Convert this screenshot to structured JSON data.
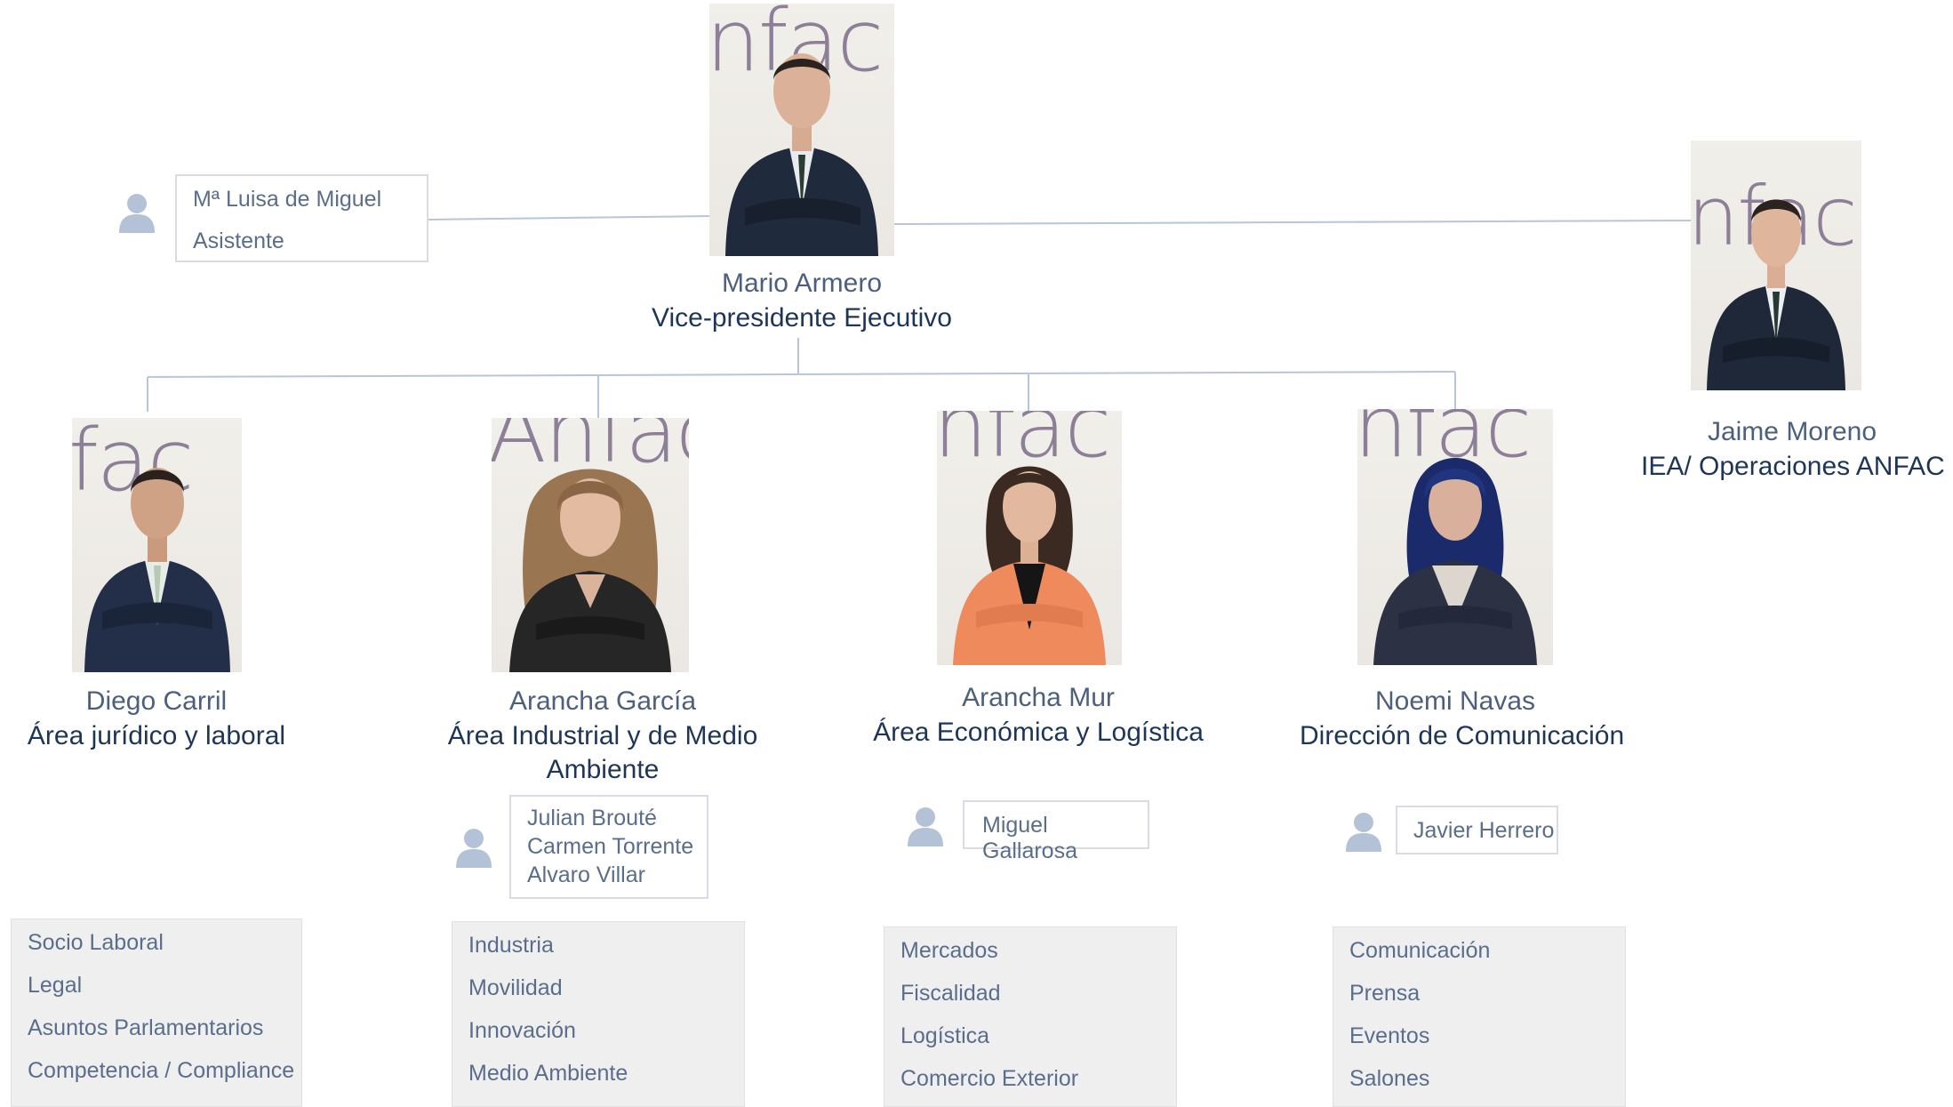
{
  "executive": {
    "name": "Mario Armero",
    "role": "Vice-presidente Ejecutivo"
  },
  "assistant": {
    "name": "Mª Luisa de Miguel",
    "title": "Asistente"
  },
  "iea": {
    "name": "Jaime Moreno",
    "role": "IEA/ Operaciones ANFAC"
  },
  "areas": [
    {
      "name": "Diego Carril",
      "role": "Área jurídico y laboral",
      "staff": [],
      "topics": [
        "Socio Laboral",
        "Legal",
        "Asuntos Parlamentarios",
        "Competencia / Compliance"
      ]
    },
    {
      "name": "Arancha García",
      "role": "Área Industrial y de Medio Ambiente",
      "staff": [
        "Julian Brouté",
        "Carmen Torrente",
        "Alvaro Villar"
      ],
      "topics": [
        "Industria",
        "Movilidad",
        "Innovación",
        "Medio Ambiente"
      ]
    },
    {
      "name": "Arancha Mur",
      "role": "Área Económica y Logística",
      "staff": [
        "Miguel Gallarosa"
      ],
      "topics": [
        "Mercados",
        "Fiscalidad",
        "Logística",
        "Comercio Exterior"
      ]
    },
    {
      "name": "Noemi Navas",
      "role": "Dirección de Comunicación",
      "staff": [
        "Javier Herrero"
      ],
      "topics": [
        "Comunicación",
        "Prensa",
        "Eventos",
        "Salones"
      ]
    }
  ],
  "photo_watermarks": [
    "nfac",
    "fac",
    "Anfac",
    "nfac",
    "nfac",
    "nfac"
  ],
  "icons": {
    "user": "user-silhouette-icon"
  },
  "colors": {
    "connector": "#b7c6da",
    "name": "#4c5f7c",
    "role": "#1d3557",
    "icon": "#b4c2d8",
    "topic_bg": "#efefef"
  }
}
